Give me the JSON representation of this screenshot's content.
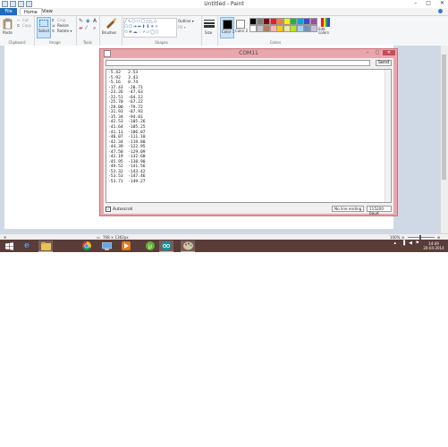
{
  "paint": {
    "title": "Untitled - Paint",
    "menu": {
      "file": "File",
      "home": "Home",
      "view": "View"
    },
    "ribbon": {
      "paste": "Paste",
      "cut": "Cut",
      "copy": "Copy",
      "crop": "Crop",
      "resize": "Resize",
      "rotate": "Rotate ▾",
      "select": "Select",
      "brushes": "Brushes",
      "outline": "Outline ▾",
      "fill": "Fill ▾",
      "size": "Size",
      "color1": "Color 1",
      "color2": "Color 2",
      "edit_colors": "Edit colors",
      "groups": {
        "clipboard": "Clipboard",
        "image": "Image",
        "tools": "Tools",
        "shapes": "Shapes",
        "colors": "Colors"
      }
    },
    "palette": [
      "#000000",
      "#7f7f7f",
      "#880015",
      "#ed1c24",
      "#ff7f27",
      "#fff200",
      "#22b14c",
      "#00a2e8",
      "#3f48cc",
      "#a349a4",
      "#ffffff",
      "#c3c3c3",
      "#b97a57",
      "#ffaec9",
      "#ffc90e",
      "#efe4b0",
      "#b5e61d",
      "#99d9ea",
      "#7092be",
      "#c8bfe7"
    ],
    "status": {
      "dimensions": "768 × 1362px",
      "zoom": "100%"
    }
  },
  "serial": {
    "title": "COM11",
    "send_label": "Send",
    "lines": [
      "-5.42   2.53",
      "-5.92   3.43",
      "-5.16   0.74",
      "-17.43  -20.71",
      "-23.26  -47.63",
      "-22.51  -64.12",
      "-25.70  -67.22",
      "-29.00  -79.72",
      "-31.93  -87.93",
      "-35.34  -94.01",
      "-42.53  -105.26",
      "-41.64  -105.25",
      "-41.11  -106.07",
      "-40.07  -111.10",
      "-42.34  -119.80",
      "-44.39  -122.95",
      "-47.50  -129.09",
      "-42.19  -132.60",
      "-45.95  -138.90",
      "-49.52  -141.56",
      "-53.32  -143.42",
      "-53.53  -147.46",
      "-53.71  -149.27"
    ],
    "autoscroll": "Autoscroll",
    "line_ending": "No line ending",
    "baud": "115200 baud"
  },
  "taskbar": {
    "time": "14:49",
    "date": "20-04-2014"
  }
}
